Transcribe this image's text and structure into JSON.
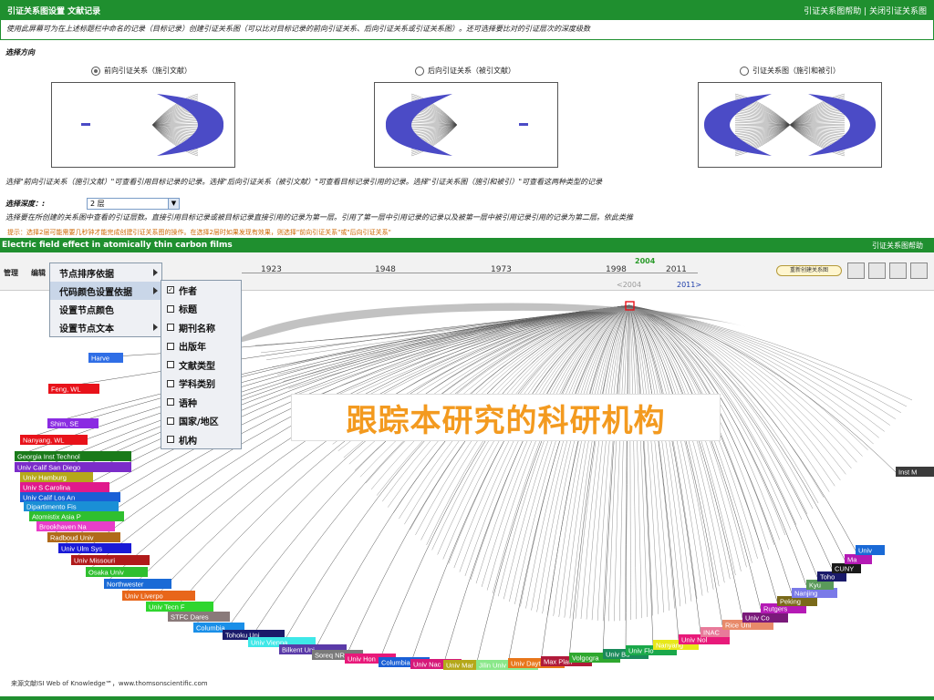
{
  "header": {
    "title": "引证关系图设置 文献记录",
    "links": "引证关系图帮助 | 关闭引证关系图"
  },
  "instructions": "使用此屏幕可为在上述标题栏中命名的记录（目标记录）创建引证关系图（可以比对目标记录的前向引证关系、后向引证关系或引证关系图）。还可选择要比对的引证层次的深度级数",
  "direction": {
    "label": "选择方向",
    "options": [
      {
        "label": "前向引证关系（施引文献）",
        "checked": true
      },
      {
        "label": "后向引证关系（被引文献）",
        "checked": false
      },
      {
        "label": "引证关系图（施引和被引）",
        "checked": false
      }
    ]
  },
  "direction_note": "选择\"前向引证关系（施引文献）\"可查看引用目标记录的记录。选择\"后向引证关系（被引文献）\"可查看目标记录引用的记录。选择\"引证关系图（施引和被引）\"可查看这两种类型的记录",
  "depth": {
    "label": "选择深度：:",
    "value": "2 层",
    "note": "选择要在所创建的关系图中查看的引证层数。直接引用目标记录或被目标记录直接引用的记录为第一层。引用了第一层中引用记录的记录以及被第一层中被引用记录引用的记录为第二层。依此类推"
  },
  "tip": "提示：选择2层可能需要几秒钟才能完成创建引证关系图的操作。在选择2层时如果发现有效果，则选择\"前向引证关系\"或\"后向引证关系\"",
  "map": {
    "paper_title": "Electric field effect in atomically thin carbon films",
    "help": "引证关系图帮助",
    "menu": [
      "管理",
      "编辑"
    ],
    "years": [
      "1923",
      "1948",
      "1973",
      "1998",
      "2011"
    ],
    "year_marker": "2004",
    "range_start": "<2004",
    "range_end": "2011>",
    "rebuild_label": "重新创建关系图"
  },
  "context_menu": [
    {
      "label": "节点排序依据",
      "submenu": true
    },
    {
      "label": "代码颜色设置依据",
      "submenu": true,
      "highlight": true
    },
    {
      "label": "设置节点颜色",
      "submenu": false
    },
    {
      "label": "设置节点文本",
      "submenu": true
    }
  ],
  "color_submenu": [
    {
      "label": "作者",
      "checked": true
    },
    {
      "label": "标题",
      "checked": false
    },
    {
      "label": "期刊名称",
      "checked": false
    },
    {
      "label": "出版年",
      "checked": false
    },
    {
      "label": "文献类型",
      "checked": false
    },
    {
      "label": "学科类别",
      "checked": false
    },
    {
      "label": "语种",
      "checked": false
    },
    {
      "label": "国家/地区",
      "checked": false
    },
    {
      "label": "机构",
      "checked": false
    }
  ],
  "banner": "跟踪本研究的科研机构",
  "footer": "来源文献ISI Web of Knowledge℠，www.thomsonscientific.com",
  "nodes_left": [
    {
      "label": "Harve",
      "color": "#2f6ee6"
    },
    {
      "label": "Feng, WL",
      "color": "#e8121a"
    },
    {
      "label": "Shim, SE",
      "color": "#8a2be2"
    },
    {
      "label": "Nanyang, WL",
      "color": "#e8121a"
    },
    {
      "label": "Georgia Inst Technol",
      "color": "#1a7a1a"
    },
    {
      "label": "Univ Calif San Diego",
      "color": "#7b2cc9"
    },
    {
      "label": "Univ Hamburg",
      "color": "#b5a81a"
    },
    {
      "label": "Univ S Carolina",
      "color": "#e0198c"
    },
    {
      "label": "Univ Calif Los An",
      "color": "#1a5fd6"
    },
    {
      "label": "Dipartimento Fis",
      "color": "#1a8fd6"
    },
    {
      "label": "Atomistix Asia P",
      "color": "#2fbf2f"
    },
    {
      "label": "Brookhaven Na",
      "color": "#e83ec9"
    },
    {
      "label": "Radboud Univ",
      "color": "#b06a1a"
    },
    {
      "label": "Univ Ulm Sys",
      "color": "#1a1ad6"
    },
    {
      "label": "Univ Missouri",
      "color": "#b01a1a"
    },
    {
      "label": "Osaka Univ",
      "color": "#2fbf2f"
    },
    {
      "label": "Northwester",
      "color": "#1a6ad6"
    },
    {
      "label": "Univ Liverpo",
      "color": "#e8661a"
    },
    {
      "label": "Univ Tecn F",
      "color": "#2fd62f"
    },
    {
      "label": "STFC Dares",
      "color": "#8a7a7a"
    },
    {
      "label": "Columbia",
      "color": "#1a8fe8"
    },
    {
      "label": "Tohoku Uni",
      "color": "#1a1a6a"
    },
    {
      "label": "Univ Vienna",
      "color": "#3ee8e8"
    },
    {
      "label": "Bilkent Uni",
      "color": "#5a3aa8"
    },
    {
      "label": "Soreq NR",
      "color": "#7a7a7a"
    }
  ],
  "nodes_bottom": [
    {
      "label": "Univ Hon",
      "color": "#e8197a"
    },
    {
      "label": "Columbia",
      "color": "#1a5fd6"
    },
    {
      "label": "Univ Nac",
      "color": "#d6197a"
    },
    {
      "label": "Univ Mar",
      "color": "#b5a81a"
    },
    {
      "label": "Jilin Univ",
      "color": "#8ae88a"
    },
    {
      "label": "Univ Dayt",
      "color": "#e8761a"
    },
    {
      "label": "Max Plan",
      "color": "#b01a3a"
    },
    {
      "label": "Volgogra",
      "color": "#2fa82f"
    },
    {
      "label": "Univ Bu",
      "color": "#1a8a5a"
    },
    {
      "label": "Univ Flo",
      "color": "#1aa84a"
    },
    {
      "label": "Nanyang",
      "color": "#e8e81a"
    },
    {
      "label": "Univ Nol",
      "color": "#e81a7a"
    },
    {
      "label": "INAC",
      "color": "#e87a9a"
    },
    {
      "label": "Rice Uni",
      "color": "#e88a6a"
    },
    {
      "label": "Univ Co",
      "color": "#7a1a7a"
    },
    {
      "label": "Rutgers",
      "color": "#b51ab5"
    },
    {
      "label": "Peking",
      "color": "#7a6a1a"
    },
    {
      "label": "Nanjing",
      "color": "#7a7ae8"
    },
    {
      "label": "Kyu",
      "color": "#5a9a5a"
    },
    {
      "label": "Toho",
      "color": "#1a1a6a"
    },
    {
      "label": "CUNY",
      "color": "#1a1a1a"
    },
    {
      "label": "Ma",
      "color": "#b51ab5"
    },
    {
      "label": "Univ",
      "color": "#1a6ad6"
    },
    {
      "label": "Inst M",
      "color": "#3a3a3a"
    }
  ]
}
